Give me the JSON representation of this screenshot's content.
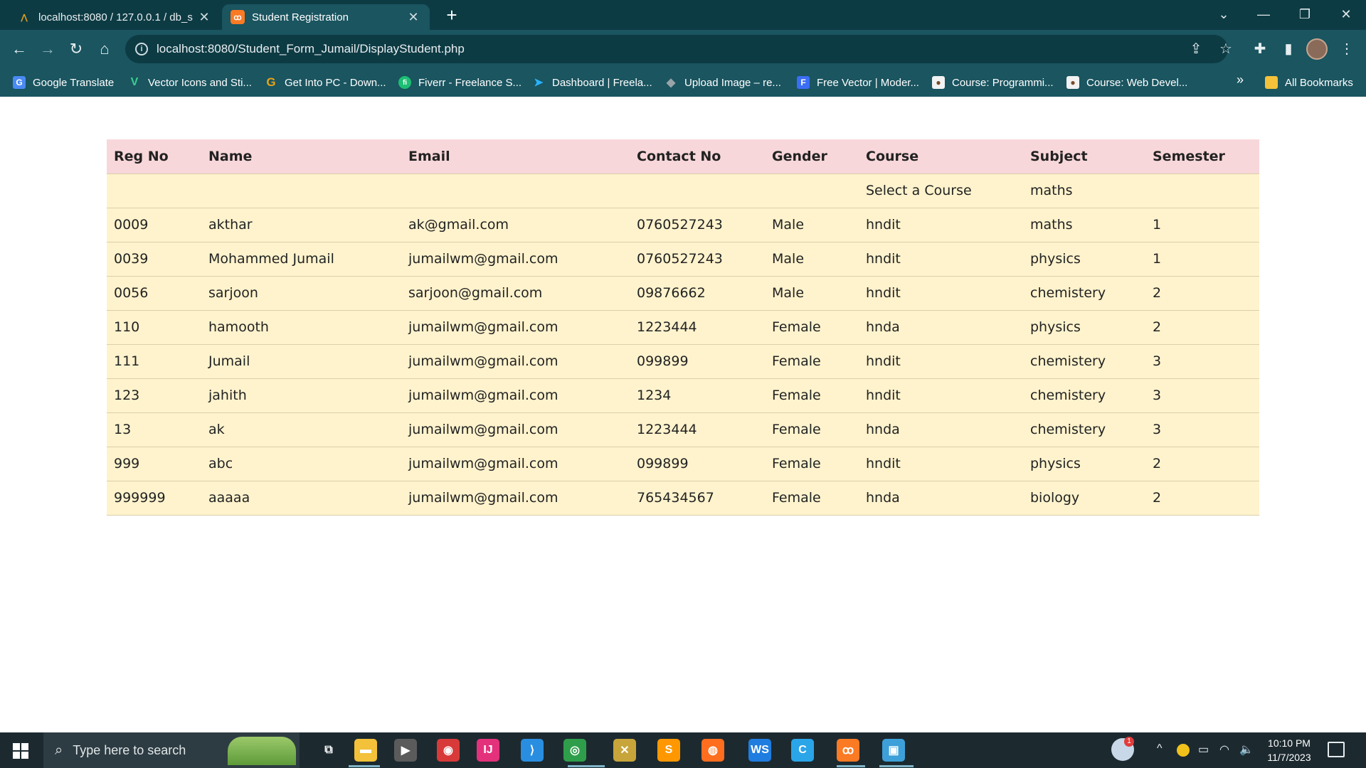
{
  "browser": {
    "tabs": [
      {
        "title": "localhost:8080 / 127.0.0.1 / db_s",
        "icon": "phpmyadmin-icon",
        "active": false
      },
      {
        "title": "Student Registration",
        "icon": "xampp-icon",
        "active": true
      }
    ],
    "address": "localhost:8080/Student_Form_Jumail/DisplayStudent.php",
    "bookmarks": [
      {
        "label": "Google Translate",
        "icon": "google-translate-icon",
        "color": "#4a8af4"
      },
      {
        "label": "Vector Icons and Sti...",
        "icon": "vector-icons-icon",
        "color": "#3ecf8e"
      },
      {
        "label": "Get Into PC - Down...",
        "icon": "getintopc-icon",
        "color": "#e8a317"
      },
      {
        "label": "Fiverr - Freelance S...",
        "icon": "fiverr-icon",
        "color": "#1dbf73"
      },
      {
        "label": "Dashboard | Freela...",
        "icon": "freelancer-icon",
        "color": "#29b2fe"
      },
      {
        "label": "Upload Image – re...",
        "icon": "upload-image-icon",
        "color": "#9aa4a8"
      },
      {
        "label": "Free Vector | Moder...",
        "icon": "freepik-icon",
        "color": "#3b6ef5"
      },
      {
        "label": "Course: Programmi...",
        "icon": "course-icon",
        "color": "#f2f2f2"
      },
      {
        "label": "Course: Web Devel...",
        "icon": "course-icon",
        "color": "#f2f2f2"
      }
    ],
    "more_bookmarks": "»",
    "all_bookmarks": "All Bookmarks"
  },
  "table": {
    "headers": [
      "Reg No",
      "Name",
      "Email",
      "Contact No",
      "Gender",
      "Course",
      "Subject",
      "Semester"
    ],
    "rows": [
      [
        "",
        "",
        "",
        "",
        "",
        "Select a Course",
        "maths",
        ""
      ],
      [
        "0009",
        "akthar",
        "ak@gmail.com",
        "0760527243",
        "Male",
        "hndit",
        "maths",
        "1"
      ],
      [
        "0039",
        "Mohammed Jumail",
        "jumailwm@gmail.com",
        "0760527243",
        "Male",
        "hndit",
        "physics",
        "1"
      ],
      [
        "0056",
        "sarjoon",
        "sarjoon@gmail.com",
        "09876662",
        "Male",
        "hndit",
        "chemistery",
        "2"
      ],
      [
        "110",
        "hamooth",
        "jumailwm@gmail.com",
        "1223444",
        "Female",
        "hnda",
        "physics",
        "2"
      ],
      [
        "111",
        "Jumail",
        "jumailwm@gmail.com",
        "099899",
        "Female",
        "hndit",
        "chemistery",
        "3"
      ],
      [
        "123",
        "jahith",
        "jumailwm@gmail.com",
        "1234",
        "Female",
        "hndit",
        "chemistery",
        "3"
      ],
      [
        "13",
        "ak",
        "jumailwm@gmail.com",
        "1223444",
        "Female",
        "hnda",
        "chemistery",
        "3"
      ],
      [
        "999",
        "abc",
        "jumailwm@gmail.com",
        "099899",
        "Female",
        "hndit",
        "physics",
        "2"
      ],
      [
        "999999",
        "aaaaa",
        "jumailwm@gmail.com",
        "765434567",
        "Female",
        "hnda",
        "biology",
        "2"
      ]
    ],
    "header_bg": "#f8d7da",
    "row_bg": "#fff3cd"
  },
  "taskbar": {
    "search_placeholder": "Type here to search",
    "apps": [
      {
        "name": "task-view-icon",
        "color": "#1c2a30"
      },
      {
        "name": "file-explorer-icon",
        "color": "#f3c13a"
      },
      {
        "name": "media-player-icon",
        "color": "#5b5b5b"
      },
      {
        "name": "screen-recorder-icon",
        "color": "#d83a3a"
      },
      {
        "name": "intellij-icon",
        "color": "#e4317b"
      },
      {
        "name": "vscode-icon",
        "color": "#2a8ee0"
      },
      {
        "name": "chrome-icon",
        "color": "#2f9e4b"
      },
      {
        "name": "tools-icon",
        "color": "#c8a53a"
      },
      {
        "name": "sublime-text-icon",
        "color": "#ff9800"
      },
      {
        "name": "firefox-icon",
        "color": "#ff6d1f"
      },
      {
        "name": "webstorm-icon",
        "color": "#1f7de0"
      },
      {
        "name": "ccleaner-icon",
        "color": "#2aa5e8"
      },
      {
        "name": "xampp-icon",
        "color": "#fb7a24"
      },
      {
        "name": "remote-desktop-icon",
        "color": "#3ea0d8"
      }
    ],
    "weather_badge": "1",
    "time": "10:10 PM",
    "date": "11/7/2023"
  }
}
